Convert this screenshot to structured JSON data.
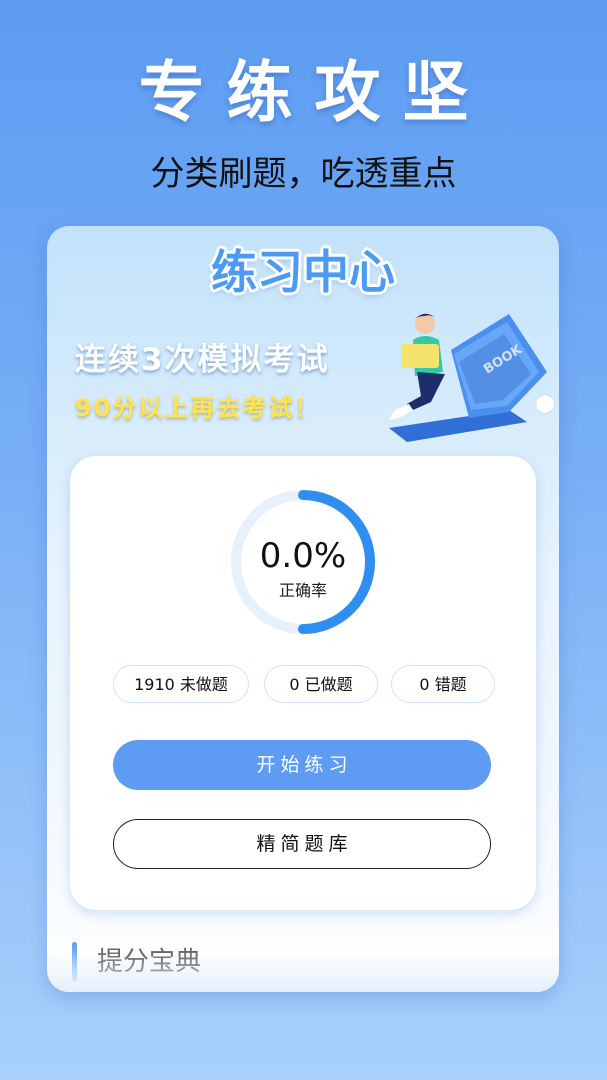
{
  "hero": {
    "title": "专练攻坚",
    "subtitle": "分类刷题，吃透重点"
  },
  "practice_center": {
    "heading": "练习中心",
    "banner_line1": "连续3次模拟考试",
    "banner_line2": "90分以上再去考试！",
    "illustration_book_text": "BOOK",
    "accuracy": {
      "value": "0.0%",
      "label": "正确率",
      "progress_fraction": 0.5
    },
    "stats": [
      {
        "label": "1910 未做题"
      },
      {
        "label": "0 已做题"
      },
      {
        "label": "0 错题"
      }
    ],
    "start_button": "开始练习",
    "refined_bank_button": "精简题库"
  },
  "section": {
    "title": "提分宝典"
  },
  "colors": {
    "accent": "#5d9cf2",
    "ring_track": "#e6f1fc",
    "banner_highlight": "#ffe44d"
  }
}
